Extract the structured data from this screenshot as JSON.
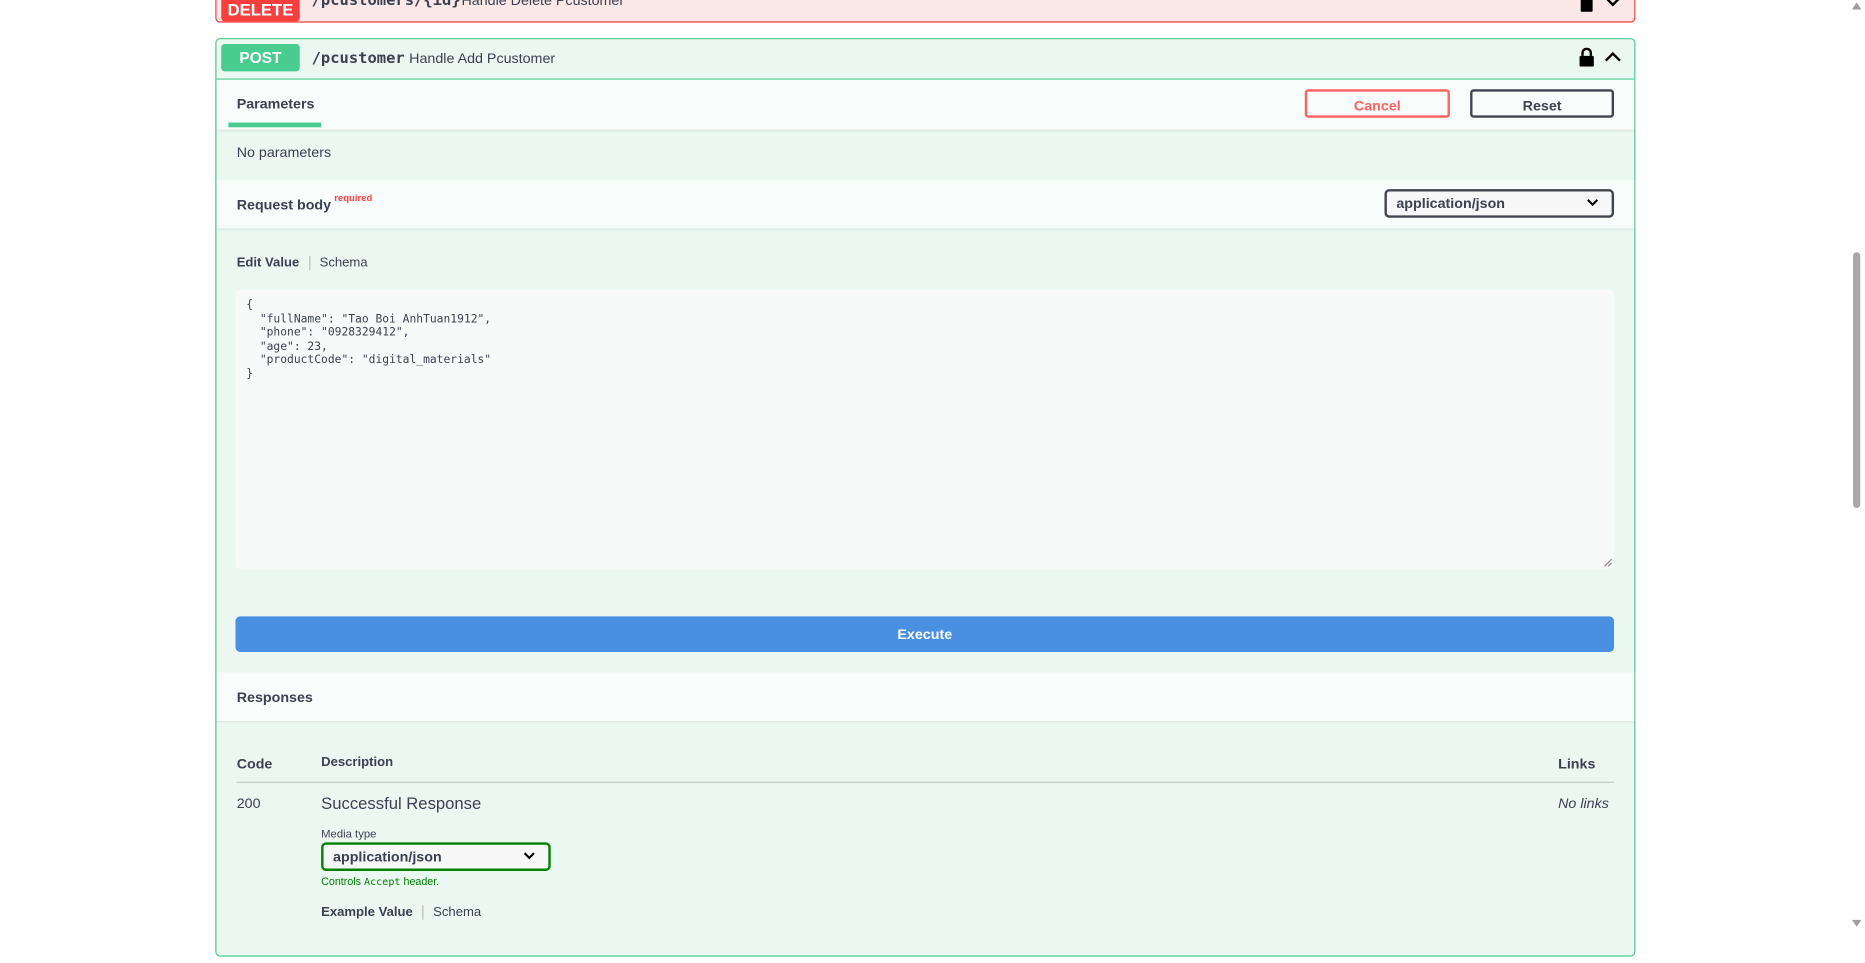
{
  "delete_op": {
    "method": "DELETE",
    "path": "/pcustomers/{id}",
    "summary": "Handle Delete Pcustomer",
    "lock_icon": "lock-icon",
    "chevron_icon": "chevron-down-icon"
  },
  "post_op": {
    "method": "POST",
    "path": "/pcustomer",
    "summary": "Handle Add Pcustomer",
    "lock_icon": "lock-icon",
    "chevron_icon": "chevron-up-icon"
  },
  "parameters": {
    "tab_label": "Parameters",
    "cancel_label": "Cancel",
    "reset_label": "Reset",
    "empty_text": "No parameters"
  },
  "request_body": {
    "title": "Request body",
    "required_label": "required",
    "content_type": "application/json",
    "edit_value_tab": "Edit Value",
    "schema_tab": "Schema",
    "json_value": "{\n  \"fullName\": \"Tao Boi AnhTuan1912\",\n  \"phone\": \"0928329412\",\n  \"age\": 23,\n  \"productCode\": \"digital_materials\"\n}"
  },
  "execute_label": "Execute",
  "responses": {
    "title": "Responses",
    "columns": {
      "code": "Code",
      "description": "Description",
      "links": "Links"
    },
    "rows": [
      {
        "code": "200",
        "description": "Successful Response",
        "links": "No links",
        "media_type_label": "Media type",
        "media_type_value": "application/json",
        "controls_prefix": "Controls ",
        "controls_code": "Accept",
        "controls_suffix": " header.",
        "example_value_tab": "Example Value",
        "schema_tab": "Schema"
      }
    ]
  },
  "colors": {
    "delete": "#f93e3e",
    "post": "#49cc90",
    "execute": "#4990e2",
    "cancel": "#ff6060",
    "media_select_border": "#008000"
  }
}
